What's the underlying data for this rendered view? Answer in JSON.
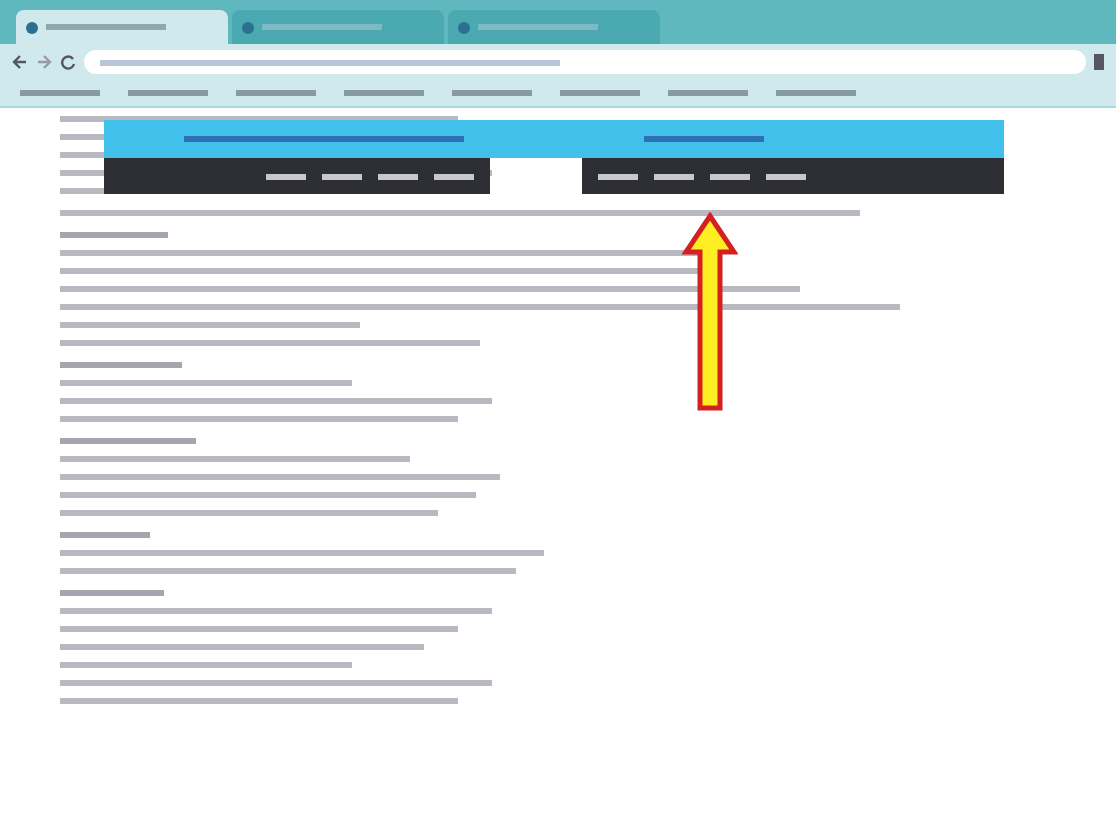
{
  "browser": {
    "tabs": [
      {
        "selected": true
      },
      {
        "selected": false
      },
      {
        "selected": false
      }
    ],
    "bookmarks": [
      {
        "kind": "link"
      },
      {
        "kind": "link"
      },
      {
        "kind": "link"
      },
      {
        "kind": "link"
      },
      {
        "kind": "link"
      },
      {
        "kind": "link"
      },
      {
        "kind": "link"
      },
      {
        "kind": "link"
      }
    ]
  },
  "overlay": {
    "menu_left": [
      {
        "kind": "link"
      },
      {
        "kind": "link"
      },
      {
        "kind": "link"
      },
      {
        "kind": "link"
      }
    ],
    "menu_right": [
      {
        "kind": "link"
      },
      {
        "kind": "link"
      },
      {
        "kind": "link"
      },
      {
        "kind": "link"
      }
    ]
  },
  "document": {
    "sections": [
      {
        "lines": [
          {
            "kind": "text"
          },
          {
            "kind": "text"
          },
          {
            "kind": "text"
          },
          {
            "kind": "text"
          },
          {
            "kind": "text"
          }
        ]
      },
      {
        "lines": [
          {
            "kind": "text"
          }
        ]
      },
      {
        "lines": [
          {
            "kind": "heading"
          },
          {
            "kind": "text"
          },
          {
            "kind": "text"
          },
          {
            "kind": "text"
          },
          {
            "kind": "text"
          },
          {
            "kind": "text"
          },
          {
            "kind": "text"
          }
        ]
      },
      {
        "lines": [
          {
            "kind": "heading"
          },
          {
            "kind": "text"
          },
          {
            "kind": "text"
          },
          {
            "kind": "text"
          }
        ]
      },
      {
        "lines": [
          {
            "kind": "heading"
          },
          {
            "kind": "text"
          },
          {
            "kind": "text"
          },
          {
            "kind": "text"
          },
          {
            "kind": "text"
          }
        ]
      },
      {
        "lines": [
          {
            "kind": "heading"
          },
          {
            "kind": "text"
          },
          {
            "kind": "text"
          }
        ]
      },
      {
        "lines": [
          {
            "kind": "heading"
          },
          {
            "kind": "text"
          },
          {
            "kind": "text"
          },
          {
            "kind": "text"
          },
          {
            "kind": "text"
          },
          {
            "kind": "text"
          },
          {
            "kind": "text"
          }
        ]
      }
    ]
  }
}
